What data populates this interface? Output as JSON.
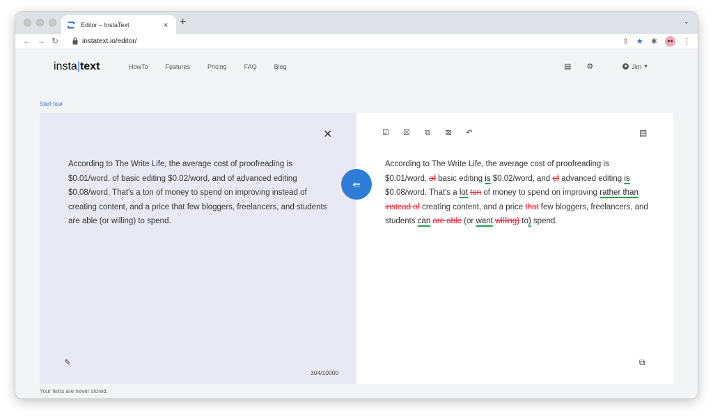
{
  "browser": {
    "tab_title": "Editor – InstaText",
    "tab_close": "×",
    "new_tab": "+",
    "url": "instatext.io/editor/"
  },
  "logo": {
    "part1": "insta",
    "bar": "|",
    "part2": "text"
  },
  "nav": [
    {
      "label": "HowTo"
    },
    {
      "label": "Features"
    },
    {
      "label": "Pricing"
    },
    {
      "label": "FAQ"
    },
    {
      "label": "Blog"
    }
  ],
  "user": {
    "name": "Jim"
  },
  "start_tour": "Start tour",
  "input": {
    "text": "According to The Write Life, the average cost of proofreading is $0.01/word, of basic editing $0.02/word, and of advanced editing $0.08/word. That's a ton of money to spend on improving instead of creating content, and a price that few bloggers, freelancers, and students are able (or willing) to spend.",
    "counter": "304/10000"
  },
  "output": {
    "segments": [
      {
        "t": "According to The Write Life, the average cost of proofreading is $0.01/word, ",
        "k": "n"
      },
      {
        "t": "of",
        "k": "d"
      },
      {
        "t": " basic editing ",
        "k": "n"
      },
      {
        "t": "is",
        "k": "a"
      },
      {
        "t": " $0.02/word, and ",
        "k": "n"
      },
      {
        "t": "of",
        "k": "d"
      },
      {
        "t": " advanced editing ",
        "k": "n"
      },
      {
        "t": "is",
        "k": "a"
      },
      {
        "t": " $0.08/word. That's a ",
        "k": "n"
      },
      {
        "t": "lot",
        "k": "a"
      },
      {
        "t": " ",
        "k": "n"
      },
      {
        "t": "ton",
        "k": "d"
      },
      {
        "t": " of money to spend on improving ",
        "k": "n"
      },
      {
        "t": "rather than",
        "k": "a"
      },
      {
        "t": " ",
        "k": "n"
      },
      {
        "t": "instead of",
        "k": "d"
      },
      {
        "t": " creating content, and a price ",
        "k": "n"
      },
      {
        "t": "that",
        "k": "d"
      },
      {
        "t": " few bloggers, freelancers, and students ",
        "k": "n"
      },
      {
        "t": "can",
        "k": "a"
      },
      {
        "t": " ",
        "k": "n"
      },
      {
        "t": "are able",
        "k": "d"
      },
      {
        "t": " (or ",
        "k": "n"
      },
      {
        "t": "want",
        "k": "a"
      },
      {
        "t": " ",
        "k": "n"
      },
      {
        "t": "willing)",
        "k": "d"
      },
      {
        "t": " to",
        "k": "n"
      },
      {
        "t": ")",
        "k": "a"
      },
      {
        "t": " spend.",
        "k": "n"
      }
    ]
  },
  "footer_note": "Your texts are never stored.",
  "colors": {
    "accent": "#2f7bd8",
    "added": "#22a34a",
    "deleted": "#e11d2e"
  }
}
